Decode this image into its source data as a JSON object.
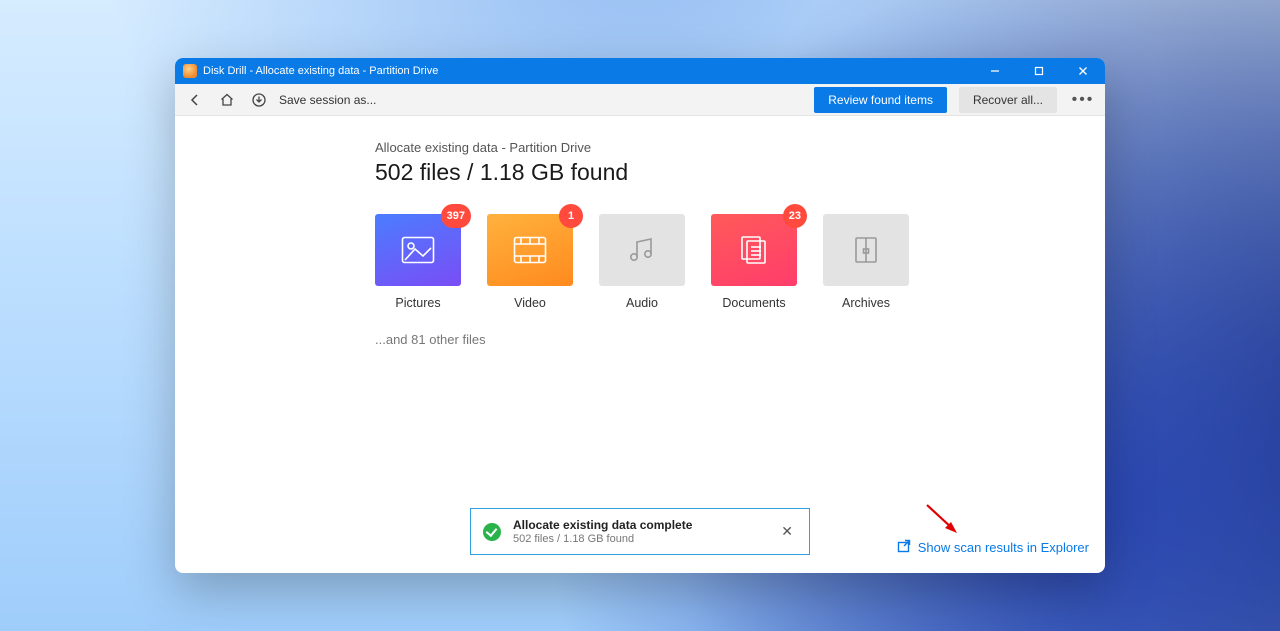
{
  "window": {
    "title": "Disk Drill - Allocate existing data - Partition Drive"
  },
  "toolbar": {
    "save_session": "Save session as...",
    "review": "Review found items",
    "recover": "Recover all..."
  },
  "main": {
    "breadcrumb": "Allocate existing data - Partition Drive",
    "heading": "502 files / 1.18 GB found",
    "other_files": "...and 81 other files",
    "categories": [
      {
        "key": "pictures",
        "label": "Pictures",
        "badge": "397"
      },
      {
        "key": "video",
        "label": "Video",
        "badge": "1"
      },
      {
        "key": "audio",
        "label": "Audio",
        "badge": null
      },
      {
        "key": "documents",
        "label": "Documents",
        "badge": "23"
      },
      {
        "key": "archives",
        "label": "Archives",
        "badge": null
      }
    ]
  },
  "toast": {
    "title": "Allocate existing data complete",
    "sub": "502 files / 1.18 GB found"
  },
  "footer": {
    "show_results": "Show scan results in Explorer"
  }
}
